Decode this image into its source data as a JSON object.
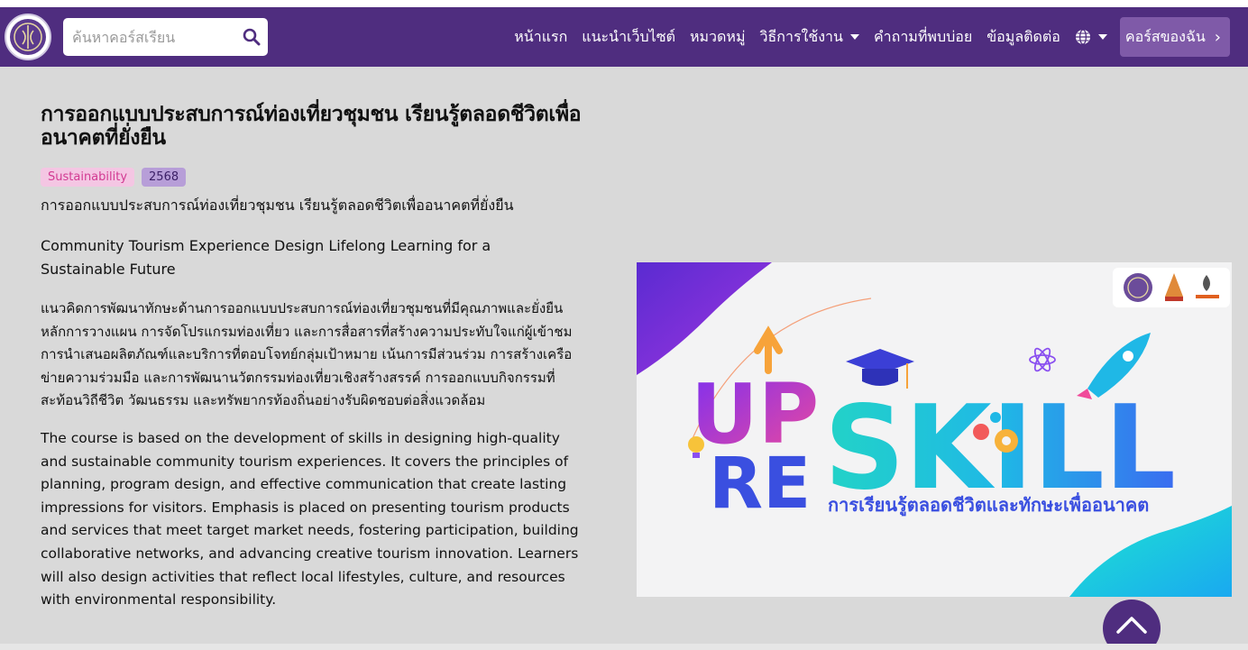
{
  "colors": {
    "nav_bg": "#4f2d7f",
    "accent": "#7f5aa8",
    "page_bg": "#d9d9d9",
    "tag_pink": "#f4c6e3",
    "tag_purple": "#b79ed8"
  },
  "search": {
    "placeholder": "ค้นหาคอร์สเรียน",
    "icon": "search-icon"
  },
  "nav": {
    "home": "หน้าแรก",
    "about": "แนะนำเว็บไซต์",
    "categories": "หมวดหมู่",
    "howto": "วิธีการใช้งาน",
    "faq": "คำถามที่พบบ่อย",
    "contact": "ข้อมูลติดต่อ",
    "language_icon": "globe-icon",
    "my_courses": "คอร์สของฉัน"
  },
  "course": {
    "title": "การออกแบบประสบการณ์ท่องเที่ยวชุมชน เรียนรู้ตลอดชีวิตเพื่ออนาคตที่ยั่งยืน",
    "tags": [
      "Sustainability",
      "2568"
    ],
    "thai_title": "การออกแบบประสบการณ์ท่องเที่ยวชุมชน เรียนรู้ตลอดชีวิตเพื่ออนาคตที่ยั่งยืน",
    "english_title": "Community Tourism Experience Design Lifelong Learning for a Sustainable Future",
    "thai_description": "แนวคิดการพัฒนาทักษะด้านการออกแบบประสบการณ์ท่องเที่ยวชุมชนที่มีคุณภาพและยั่งยืน หลักการวางแผน การจัดโปรแกรมท่องเที่ยว และการสื่อสารที่สร้างความประทับใจแก่ผู้เข้าชม การนำเสนอผลิตภัณฑ์และบริการที่ตอบโจทย์กลุ่มเป้าหมาย เน้นการมีส่วนร่วม การสร้างเครือข่ายความร่วมมือ และการพัฒนานวัตกรรมท่องเที่ยวเชิงสร้างสรรค์ การออกแบบกิจกรรมที่สะท้อนวิถีชีวิต วัฒนธรรม และทรัพยากรท้องถิ่นอย่างรับผิดชอบต่อสิ่งแวดล้อม",
    "english_description": "The course is based on the development of skills in designing high-quality and sustainable community tourism experiences. It covers the principles of planning, program design, and effective communication that create lasting impressions for visitors. Emphasis is placed on presenting tourism products and services that meet target market needs, fostering participation, building collaborative networks, and advancing creative tourism innovation. Learners will also design activities that reflect local lifestyles, culture, and resources with environmental responsibility."
  },
  "banner": {
    "word_up": "UP",
    "word_re": "RE",
    "word_skill": "SKILL",
    "subtitle": "การเรียนรู้ตลอดชีวิตและทักษะเพื่ออนาคต"
  }
}
